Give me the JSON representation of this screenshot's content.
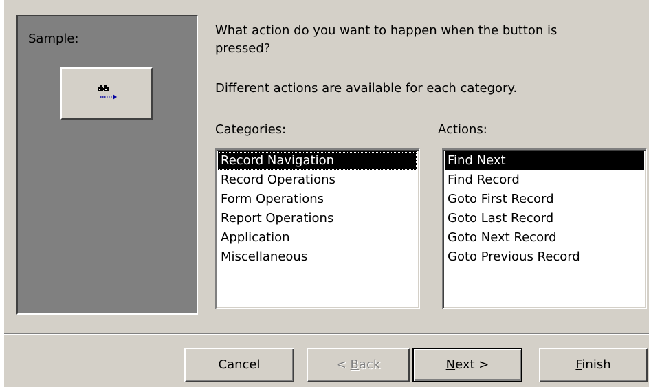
{
  "sample": {
    "label": "Sample:",
    "button_icon": "binoculars-arrow-icon"
  },
  "prompt": {
    "question": "What action do you want to happen when the button is pressed?",
    "hint": "Different actions are available for each category."
  },
  "categories": {
    "label": "Categories:",
    "items": [
      {
        "label": "Record Navigation",
        "selected": true
      },
      {
        "label": "Record Operations",
        "selected": false
      },
      {
        "label": "Form Operations",
        "selected": false
      },
      {
        "label": "Report Operations",
        "selected": false
      },
      {
        "label": "Application",
        "selected": false
      },
      {
        "label": "Miscellaneous",
        "selected": false
      }
    ]
  },
  "actions": {
    "label": "Actions:",
    "items": [
      {
        "label": "Find Next",
        "selected": true
      },
      {
        "label": "Find Record",
        "selected": false
      },
      {
        "label": "Goto First Record",
        "selected": false
      },
      {
        "label": "Goto Last Record",
        "selected": false
      },
      {
        "label": "Goto Next Record",
        "selected": false
      },
      {
        "label": "Goto Previous Record",
        "selected": false
      }
    ]
  },
  "buttons": {
    "cancel": "Cancel",
    "back_prefix": "< ",
    "back_accel": "B",
    "back_rest": "ack",
    "next_accel": "N",
    "next_rest": "ext >",
    "finish_accel": "F",
    "finish_rest": "inish"
  },
  "colors": {
    "face": "#d4d0c8",
    "sample_bg": "#808080",
    "selection": "#000000"
  }
}
